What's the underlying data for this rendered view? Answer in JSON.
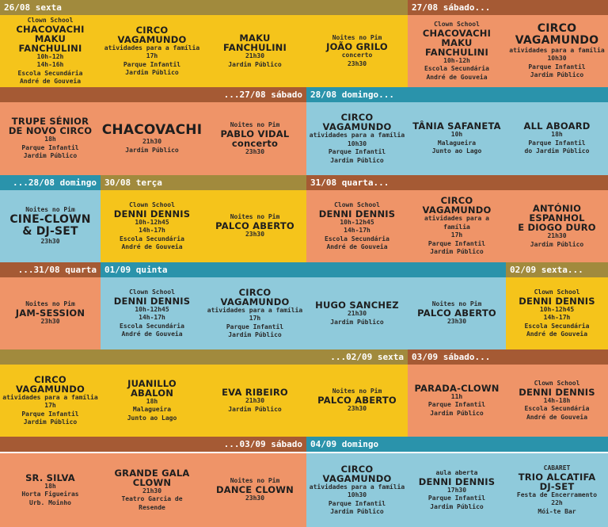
{
  "colors": {
    "header_olive": "#a18a3d",
    "header_brown": "#a55a34",
    "header_teal": "#2a93ab",
    "yellow": "#f5c41b",
    "orange": "#ef9468",
    "blue": "#8fcadb"
  },
  "headers": [
    "26/08 sexta",
    "27/08 sábado...",
    "...27/08 sábado",
    "28/08 domingo...",
    "...28/08 domingo",
    "30/08 terça",
    "31/08 quarta...",
    "...31/08 quarta",
    "01/09 quinta",
    "02/09 sexta...",
    "...02/09 sexta",
    "03/09 sábado...",
    "...03/09 sábado",
    "04/09 domingo"
  ],
  "events": [
    {
      "pre": "Clown School",
      "title": "CHACOVACHI\nMAKU FANCHULINI",
      "details": "10h-12h\n14h-16h\nEscola Secundária\nAndré de Gouveia"
    },
    {
      "pre": "",
      "title": "CIRCO VAGAMUNDO",
      "details": "atividades para a família\n17h\nParque Infantil\nJardim Público"
    },
    {
      "pre": "",
      "title": "MAKU\nFANCHULINI",
      "details": "21h30\nJardim Público"
    },
    {
      "pre": "Noites no Pim",
      "title": "JOÃO GRILO",
      "details": "concerto\n23h30"
    },
    {
      "pre": "Clown School",
      "title": "CHACOVACHI\nMAKU FANCHULINI",
      "details": "10h-12h\nEscola Secundária\nAndré de Gouveia"
    },
    {
      "pre": "",
      "title": "CIRCO VAGAMUNDO",
      "details": "atividades para a família\n10h30\nParque Infantil\nJardim Público"
    },
    {
      "pre": "",
      "title": "TRUPE SÉNIOR\nDE NOVO CIRCO",
      "details": "18h\nParque Infantil\nJardim Público"
    },
    {
      "pre": "",
      "title": "CHACOVACHI",
      "details": "21h30\nJardim Público"
    },
    {
      "pre": "Noites no Pim",
      "title": "PABLO VIDAL\nconcerto",
      "details": "23h30"
    },
    {
      "pre": "",
      "title": "CIRCO VAGAMUNDO",
      "details": "atividades para a família\n10h30\nParque Infantil\nJardim Público"
    },
    {
      "pre": "",
      "title": "TÂNIA SAFANETA",
      "details": "10h\nMalagueira\nJunto ao Lago"
    },
    {
      "pre": "",
      "title": "ALL ABOARD",
      "details": "18h\nParque Infantil\ndo Jardim Público"
    },
    {
      "pre": "Noites no Pim",
      "title": "CINE-CLOWN\n& DJ-SET",
      "details": "23h30"
    },
    {
      "pre": "Clown School",
      "title": "DENNI DENNIS",
      "details": "10h-12h45\n14h-17h\nEscola Secundária\nAndré de Gouveia"
    },
    {
      "pre": "Noites no Pim",
      "title": "PALCO ABERTO",
      "details": "23h30"
    },
    {
      "pre": "Clown School",
      "title": "DENNI DENNIS",
      "details": "10h-12h45\n14h-17h\nEscola Secundária\nAndré de Gouveia"
    },
    {
      "pre": "",
      "title": "CIRCO VAGAMUNDO",
      "details": "atividades para a família\n17h\nParque Infantil\nJardim Público"
    },
    {
      "pre": "",
      "title": "ANTÓNIO ESPANHOL\nE DIOGO DURO",
      "details": "21h30\nJardim Público"
    },
    {
      "pre": "Noites no Pim",
      "title": "JAM-SESSION",
      "details": "23h30"
    },
    {
      "pre": "Clown School",
      "title": "DENNI DENNIS",
      "details": "10h-12h45\n14h-17h\nEscola Secundária\nAndré de Gouveia"
    },
    {
      "pre": "",
      "title": "CIRCO VAGAMUNDO",
      "details": "atividades para a família\n17h\nParque Infantil\nJardim Público"
    },
    {
      "pre": "",
      "title": "HUGO SANCHEZ",
      "details": "21h30\nJardim Público"
    },
    {
      "pre": "Noites no Pim",
      "title": "PALCO ABERTO",
      "details": "23h30"
    },
    {
      "pre": "Clown School",
      "title": "DENNI DENNIS",
      "details": "10h-12h45\n14h-17h\nEscola Secundária\nAndré de Gouveia"
    },
    {
      "pre": "",
      "title": "CIRCO VAGAMUNDO",
      "details": "atividades para a família\n17h\nParque Infantil\nJardim Público"
    },
    {
      "pre": "",
      "title": "JUANILLO\nABALON",
      "details": "18h\nMalagueira\nJunto ao Lago"
    },
    {
      "pre": "",
      "title": "EVA RIBEIRO",
      "details": "21h30\nJardim Público"
    },
    {
      "pre": "Noites no Pim",
      "title": "PALCO ABERTO",
      "details": "23h30"
    },
    {
      "pre": "",
      "title": "PARADA-CLOWN",
      "details": "11h\nParque Infantil\nJardim Público"
    },
    {
      "pre": "Clown School",
      "title": "DENNI DENNIS",
      "details": "14h-18h\nEscola Secundária\nAndré de Gouveia"
    },
    {
      "pre": "",
      "title": "SR. SILVA",
      "details": "18h\nHorta Figueiras\nUrb. Moinho"
    },
    {
      "pre": "",
      "title": "GRANDE GALA\nCLOWN",
      "details": "21h30\nTeatro Garcia de\nResende"
    },
    {
      "pre": "Noites no Pim",
      "title": "DANCE CLOWN",
      "details": "23h30"
    },
    {
      "pre": "",
      "title": "CIRCO VAGAMUNDO",
      "details": "atividades para a família\n10h30\nParque Infantil\nJardim Público"
    },
    {
      "pre": "aula aberta",
      "title": "DENNI DENNIS",
      "details": "17h30\nParque Infantil\nJardim Público"
    },
    {
      "pre": "CABARET",
      "title": "TRIO ALCATIFA\nDJ-SET",
      "details": "Festa de Encerramento\n22h\nMói-te Bar"
    }
  ]
}
